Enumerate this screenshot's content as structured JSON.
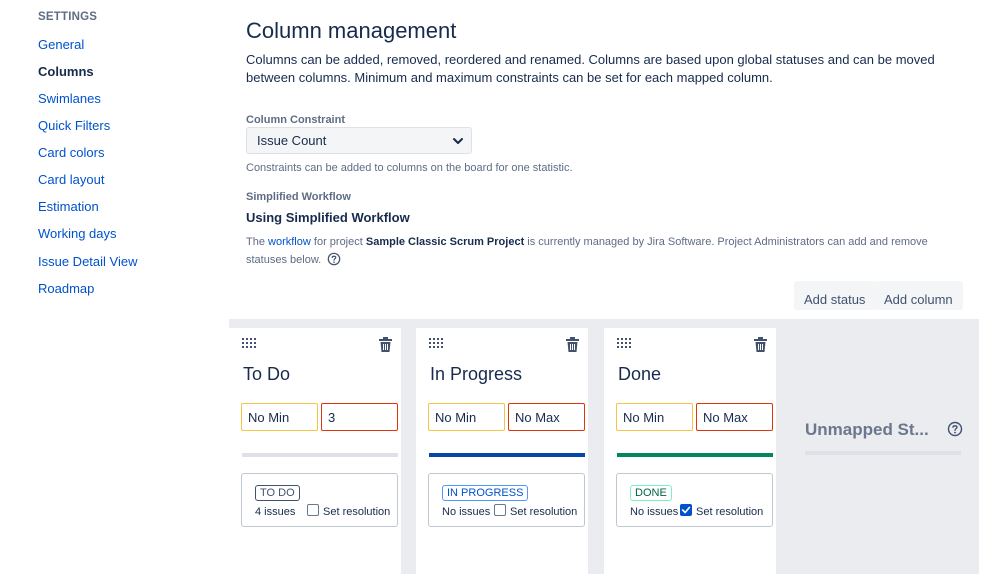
{
  "sidebar": {
    "heading": "SETTINGS",
    "items": [
      {
        "label": "General"
      },
      {
        "label": "Columns"
      },
      {
        "label": "Swimlanes"
      },
      {
        "label": "Quick Filters"
      },
      {
        "label": "Card colors"
      },
      {
        "label": "Card layout"
      },
      {
        "label": "Estimation"
      },
      {
        "label": "Working days"
      },
      {
        "label": "Issue Detail View"
      },
      {
        "label": "Roadmap"
      }
    ]
  },
  "main": {
    "title": "Column management",
    "intro": "Columns can be added, removed, reordered and renamed. Columns are based upon global statuses and can be moved between columns. Minimum and maximum constraints can be set for each mapped column.",
    "constraint": {
      "label": "Column Constraint",
      "value": "Issue Count",
      "help": "Constraints can be added to columns on the board for one statistic."
    },
    "workflow": {
      "label": "Simplified Workflow",
      "title": "Using Simplified Workflow",
      "desc_pre": "The",
      "link": "workflow",
      "desc_mid": "for project",
      "project": "Sample Classic Scrum Project",
      "desc_post": "is currently managed by Jira Software. Project Administrators can add and remove statuses below."
    },
    "buttons": {
      "add_status": "Add status",
      "add_column": "Add column"
    }
  },
  "board": {
    "columns": [
      {
        "title": "To Do",
        "min": "No Min",
        "max": "3",
        "status": "TO DO",
        "issues": "4 issues",
        "set_resolution": "Set resolution",
        "resolution_checked": false,
        "bar_color": "#dfe1e6",
        "lozenge_color": "#42526e"
      },
      {
        "title": "In Progress",
        "min": "No Min",
        "max": "No Max",
        "status": "IN PROGRESS",
        "issues": "No issues",
        "set_resolution": "Set resolution",
        "resolution_checked": false,
        "bar_color": "#0747a6",
        "lozenge_color": "#0052cc"
      },
      {
        "title": "Done",
        "min": "No Min",
        "max": "No Max",
        "status": "DONE",
        "issues": "No issues",
        "set_resolution": "Set resolution",
        "resolution_checked": true,
        "bar_color": "#00875a",
        "lozenge_color": "#006644"
      }
    ],
    "unmapped": {
      "title": "Unmapped St..."
    }
  }
}
